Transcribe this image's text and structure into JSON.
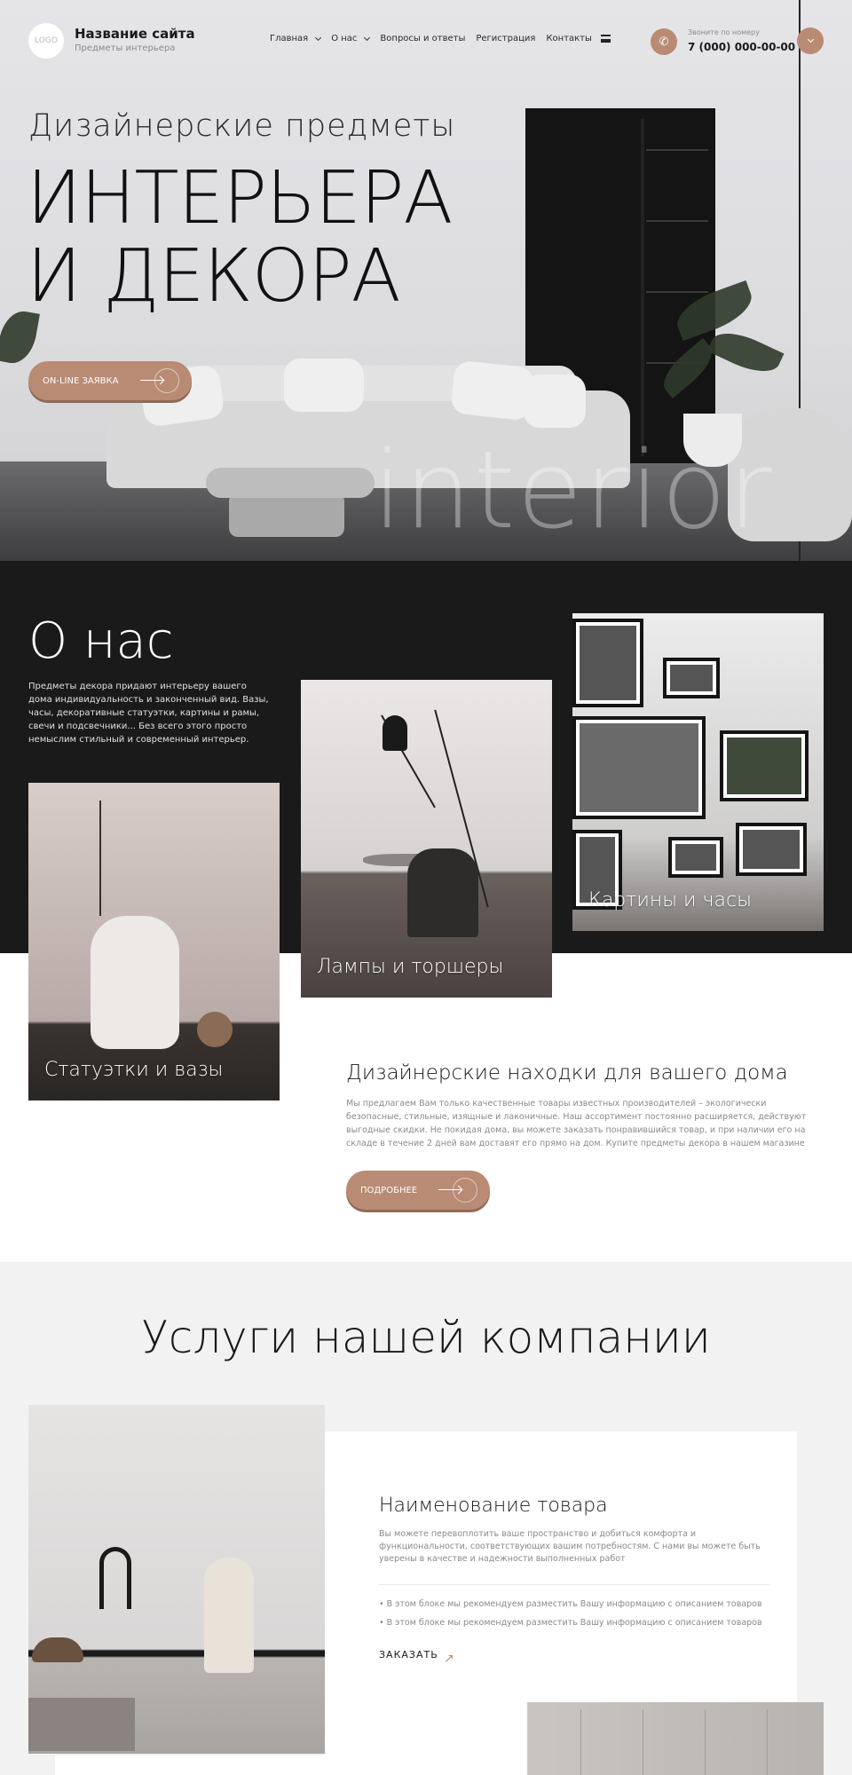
{
  "header": {
    "logo_text": "LOGO",
    "site_name": "Название сайта",
    "site_sub": "Предметы интерьера",
    "nav": [
      {
        "label": "Главная",
        "dropdown": true
      },
      {
        "label": "О нас",
        "dropdown": true
      },
      {
        "label": "Вопросы и ответы",
        "dropdown": false
      },
      {
        "label": "Регистрация",
        "dropdown": false
      },
      {
        "label": "Контакты",
        "dropdown": false
      }
    ],
    "phone_caption": "Звоните по номеру",
    "phone_number": "7 (000) 000-00-00"
  },
  "hero": {
    "subtitle": "Дизайнерские предметы",
    "title": "ИНТЕРЬЕРА И ДЕКОРА",
    "cta": "ON-LINE ЗАЯВКА",
    "watermark": "interior"
  },
  "about": {
    "heading": "О нас",
    "text": "Предметы декора придают интерьеру вашего дома индивидуальность и законченный вид. Вазы, часы, декоративные статуэтки, картины и рамы, свечи и подсвечники... Без всего этого просто немыслим стильный и современный интерьер.",
    "cards": [
      "Статуэтки и вазы",
      "Лампы и торшеры",
      "Картины и часы"
    ],
    "finds_heading": "Дизайнерские находки для вашего дома",
    "finds_text": "Мы предлагаем Вам только качественные товары известных производителей – экологически безопасные, стильные, изящные и лаконичные. Наш ассортимент постоянно расширяется, действуют выгодные скидки. Не покидая дома, вы можете заказать понравившийся товар, и при наличии его на складе в течение 2 дней вам доставят его прямо на дом. Купите предметы декора в нашем магазине",
    "more": "ПОДРОБНЕЕ"
  },
  "services": {
    "heading": "Услуги нашей компании",
    "item": {
      "title": "Наименование товара",
      "desc": "Вы можете перевоплотить ваше пространство и добиться комфорта и функциональности, соответствующих вашим потребностям. С нами вы можете быть уверены в качестве и надежности выполненных работ",
      "bullets": [
        "В этом блоке мы рекомендуем разместить Вашу информацию с описанием товаров",
        "В этом блоке мы рекомендуем разместить Вашу информацию с описанием товаров"
      ],
      "order": "ЗАКАЗАТЬ"
    }
  },
  "colors": {
    "accent": "#b98b74",
    "dark": "#1a1a1b",
    "light_bg": "#f2f2f2"
  }
}
